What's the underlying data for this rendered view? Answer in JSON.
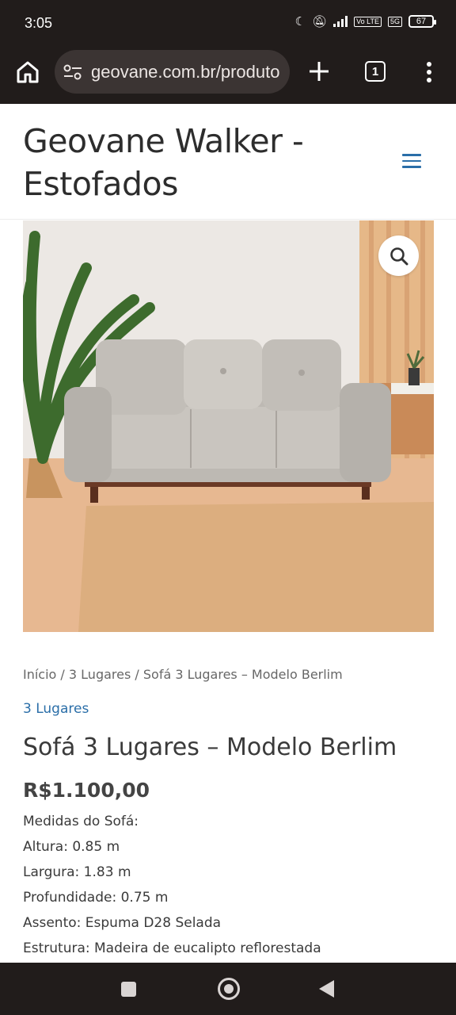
{
  "status_bar": {
    "time": "3:05",
    "battery": "67",
    "network_tag_1": "Vo LTE",
    "network_tag_2": "5G",
    "icons": [
      "moon-icon",
      "mute-icon",
      "signal-icon",
      "volte-icon",
      "5g-signal-icon",
      "battery-icon"
    ]
  },
  "browser": {
    "url": "geovane.com.br/produto",
    "tab_count": "1",
    "icons": [
      "home-icon",
      "tune-icon",
      "plus-icon",
      "tabs-icon",
      "more-vert-icon"
    ]
  },
  "site": {
    "title": "Geovane Walker - Estofados",
    "menu_icon": "hamburger-menu-icon",
    "accent_color": "#2a6ea8"
  },
  "product": {
    "image_alt": "Sofá 3 Lugares – Modelo Berlim",
    "zoom_icon": "magnifier-icon",
    "breadcrumb": {
      "home": "Início",
      "separator": " / ",
      "category": "3 Lugares",
      "current": "Sofá 3 Lugares – Modelo Berlim"
    },
    "category_link": "3 Lugares",
    "title": "Sofá 3 Lugares – Modelo Berlim",
    "price": "R$1.100,00",
    "description": [
      "Medidas do Sofá:",
      "Altura: 0.85 m",
      "Largura: 1.83 m",
      "Profundidade: 0.75 m",
      "Assento: Espuma D28 Selada",
      "Estrutura: Madeira de eucalipto reflorestada"
    ]
  },
  "nav_bar": {
    "icons": [
      "recents-icon",
      "home-circle-icon",
      "back-icon"
    ]
  }
}
